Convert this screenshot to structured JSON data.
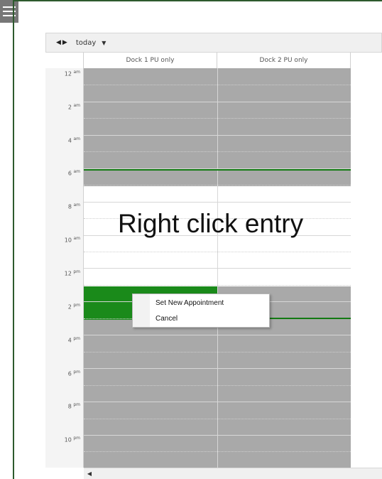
{
  "menu_icon": "hamburger-menu-icon",
  "toolbar": {
    "prev_icon": "arrow-left-icon",
    "next_icon": "arrow-right-icon",
    "today_label": "today",
    "caret_icon": "caret-down-icon"
  },
  "columns": [
    "Dock 1 PU only",
    "Dock 2 PU only"
  ],
  "time_labels": [
    {
      "hour": "12",
      "ampm": "am"
    },
    {
      "hour": "2",
      "ampm": "am"
    },
    {
      "hour": "4",
      "ampm": "am"
    },
    {
      "hour": "6",
      "ampm": "am"
    },
    {
      "hour": "8",
      "ampm": "am"
    },
    {
      "hour": "10",
      "ampm": "am"
    },
    {
      "hour": "12",
      "ampm": "pm"
    },
    {
      "hour": "2",
      "ampm": "pm"
    },
    {
      "hour": "4",
      "ampm": "pm"
    },
    {
      "hour": "6",
      "ampm": "pm"
    },
    {
      "hour": "8",
      "ampm": "pm"
    },
    {
      "hour": "10",
      "ampm": "pm"
    }
  ],
  "overlay_text": "Right click entry",
  "context_menu": {
    "items": [
      "Set New Appointment",
      "Cancel"
    ]
  },
  "colors": {
    "booked": "#1a8a1a",
    "unavailable": "#a9a9a9",
    "current_time_line": "#137a13"
  },
  "scroll_left_icon": "scroll-left-arrow-icon"
}
